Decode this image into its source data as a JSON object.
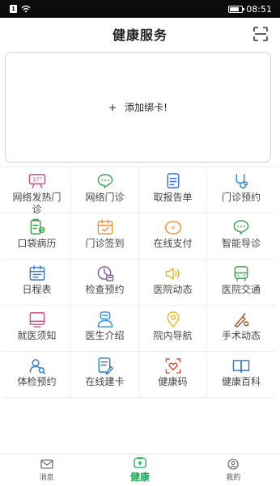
{
  "status_bar": {
    "sim_label": "1",
    "time": "08:51",
    "battery_level": 0.8
  },
  "header": {
    "title": "健康服务"
  },
  "card": {
    "plus": "+",
    "label": "添加绑卡!"
  },
  "services": [
    {
      "label": "网络发热门诊",
      "icon": "fever-clinic-icon",
      "color": "#c94c8c"
    },
    {
      "label": "网络门诊",
      "icon": "online-clinic-icon",
      "color": "#3aa64a"
    },
    {
      "label": "取报告单",
      "icon": "report-icon",
      "color": "#3a6fd0"
    },
    {
      "label": "门诊预约",
      "icon": "stethoscope-icon",
      "color": "#2f8ad6"
    },
    {
      "label": "口袋病历",
      "icon": "medical-record-icon",
      "color": "#3aa64a"
    },
    {
      "label": "门诊签到",
      "icon": "checkin-icon",
      "color": "#f0903a"
    },
    {
      "label": "在线支付",
      "icon": "payment-icon",
      "color": "#f0903a"
    },
    {
      "label": "智能导诊",
      "icon": "smart-guide-icon",
      "color": "#3aa64a"
    },
    {
      "label": "日程表",
      "icon": "calendar-icon",
      "color": "#2f78c8"
    },
    {
      "label": "检查预约",
      "icon": "exam-booking-icon",
      "color": "#7a5aa8"
    },
    {
      "label": "医院动态",
      "icon": "speaker-icon",
      "color": "#e8b820"
    },
    {
      "label": "医院交通",
      "icon": "bus-icon",
      "color": "#3aa64a"
    },
    {
      "label": "就医须知",
      "icon": "notice-icon",
      "color": "#c94c8c"
    },
    {
      "label": "医生介绍",
      "icon": "doctor-icon",
      "color": "#2f8ad6"
    },
    {
      "label": "院内导航",
      "icon": "location-icon",
      "color": "#e8b820"
    },
    {
      "label": "手术动态",
      "icon": "surgery-icon",
      "color": "#a0522d"
    },
    {
      "label": "体检预约",
      "icon": "checkup-icon",
      "color": "#2f78c8"
    },
    {
      "label": "在线建卡",
      "icon": "create-card-icon",
      "color": "#2f78c8"
    },
    {
      "label": "健康码",
      "icon": "health-code-icon",
      "color": "#e8452f"
    },
    {
      "label": "健康百科",
      "icon": "encyclopedia-icon",
      "color": "#2f78c8"
    }
  ],
  "tabbar": {
    "messages": "消息",
    "health": "健康",
    "mine": "我的",
    "active_color": "#1aab55"
  }
}
